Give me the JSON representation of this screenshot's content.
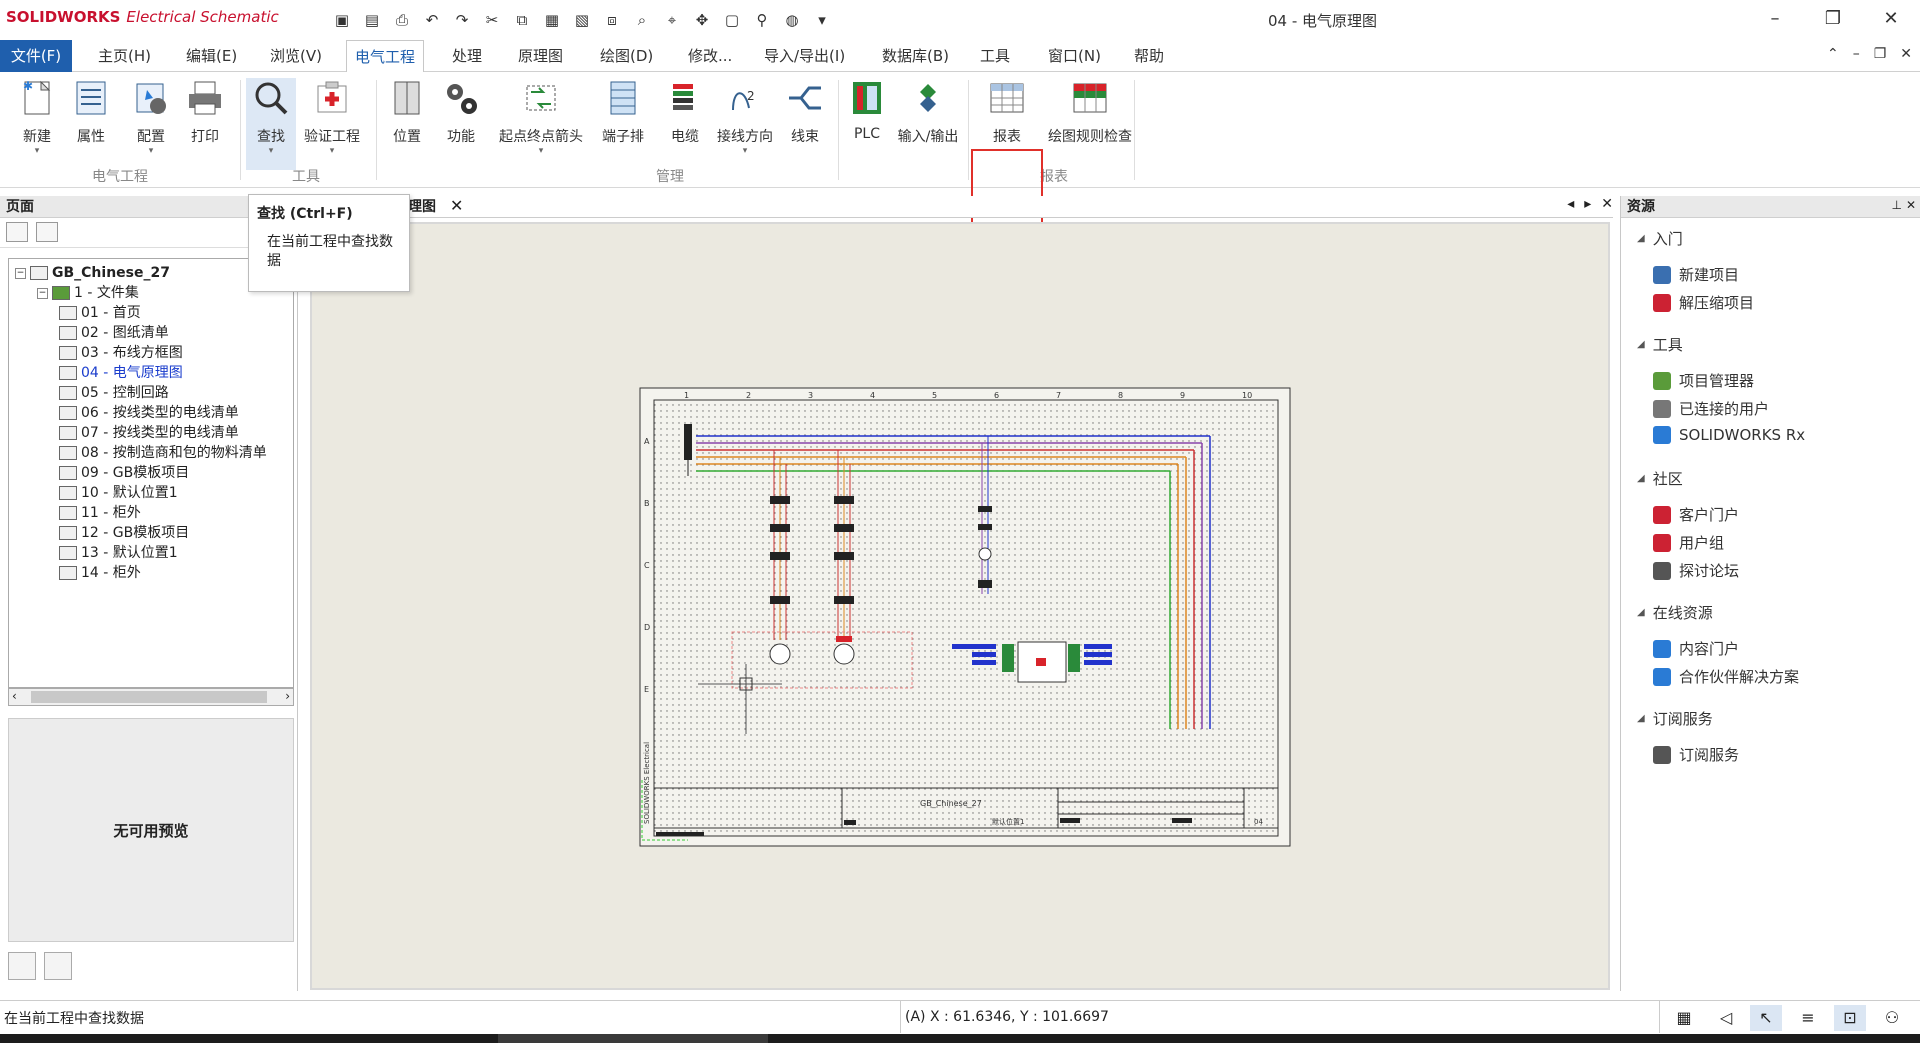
{
  "app": {
    "logo_brand": "SOLIDWORKS",
    "logo_sub": "Electrical Schematic",
    "window_title": "04 - 电气原理图"
  },
  "menu": {
    "file": "文件(F)",
    "home": "主页(H)",
    "edit": "编辑(E)",
    "view": "浏览(V)",
    "electrical": "电气工程",
    "process": "处理",
    "schematic": "原理图",
    "drawing": "绘图(D)",
    "modify": "修改...",
    "import_export": "导入/导出(I)",
    "database": "数据库(B)",
    "tools": "工具",
    "window": "窗口(N)",
    "help": "帮助"
  },
  "ribbon": {
    "new": "新建",
    "properties": "属性",
    "config": "配置",
    "print": "打印",
    "search": "查找",
    "verify": "验证工程",
    "location": "位置",
    "function": "功能",
    "origin_dest": "起点终点箭头",
    "terminal": "端子排",
    "cable": "电缆",
    "wiring_dir": "接线方向",
    "harness": "线束",
    "plc": "PLC",
    "io": "输入/输出",
    "report": "报表",
    "drawing_check": "绘图规则检查",
    "group_project": "电气工程",
    "group_tools": "工具",
    "group_manage": "管理",
    "group_reports": "报表"
  },
  "tooltip": {
    "title": "查找 (Ctrl+F)",
    "desc": "在当前工程中查找数据"
  },
  "left_panel": {
    "title": "页面",
    "tree": [
      {
        "label": "GB_Chinese_27",
        "level": 0
      },
      {
        "label": "1 - 文件集",
        "level": 1
      },
      {
        "label": "01 - 首页",
        "level": 2
      },
      {
        "label": "02 - 图纸清单",
        "level": 2
      },
      {
        "label": "03 - 布线方框图",
        "level": 2
      },
      {
        "label": "04 - 电气原理图",
        "level": 2,
        "selected": true
      },
      {
        "label": "05 - 控制回路",
        "level": 2
      },
      {
        "label": "06 - 按线类型的电线清单",
        "level": 2
      },
      {
        "label": "07 - 按线类型的电线清单",
        "level": 2
      },
      {
        "label": "08 - 按制造商和包的物料清单",
        "level": 2
      },
      {
        "label": "09 - GB模板项目",
        "level": 2
      },
      {
        "label": "10 - 默认位置1",
        "level": 2
      },
      {
        "label": "11 - 柜外",
        "level": 2
      },
      {
        "label": "12 - GB模板项目",
        "level": 2
      },
      {
        "label": "13 - 默认位置1",
        "level": 2
      },
      {
        "label": "14 - 柜外",
        "level": 2
      }
    ],
    "preview_text": "无可用预览"
  },
  "doc_tab": {
    "label": "理图"
  },
  "drawing": {
    "col_numbers": [
      "1",
      "2",
      "3",
      "4",
      "5",
      "6",
      "7",
      "8",
      "9",
      "10"
    ],
    "row_letters": [
      "A",
      "B",
      "C",
      "D",
      "E"
    ],
    "side_text": "SOLIDWORKS Electrical",
    "titleblock_name": "GB_Chinese_27",
    "titleblock_page": "04",
    "titleblock_loc": "默认位置1"
  },
  "right_panel": {
    "title": "资源",
    "sections": [
      {
        "label": "入门",
        "items": [
          "新建项目",
          "解压缩项目"
        ]
      },
      {
        "label": "工具",
        "items": [
          "项目管理器",
          "已连接的用户",
          "SOLIDWORKS Rx"
        ]
      },
      {
        "label": "社区",
        "items": [
          "客户门户",
          "用户组",
          "探讨论坛"
        ]
      },
      {
        "label": "在线资源",
        "items": [
          "内容门户",
          "合作伙伴解决方案"
        ]
      },
      {
        "label": "订阅服务",
        "items": [
          "订阅服务"
        ]
      }
    ]
  },
  "status": {
    "message": "在当前工程中查找数据",
    "coords": "(A) X : 61.6346, Y : 101.6697"
  },
  "colors": {
    "accent": "#1f5fad",
    "highlight_box": "#e0302a",
    "canvas_bg": "#ebe9e0"
  }
}
